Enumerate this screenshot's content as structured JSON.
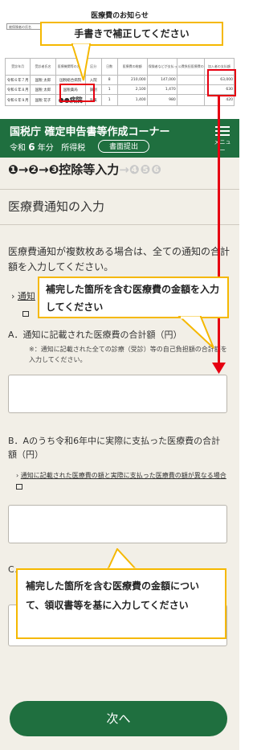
{
  "notice": {
    "title": "医療費のお知らせ",
    "insurer_label": "被保険者の氏名",
    "table_headers": [
      "受診年月",
      "受診者氏名",
      "医療機関等の名称",
      "区分",
      "日数",
      "医療費の総額",
      "保険者などが支払った額",
      "公費負担医療費の額",
      "加入者の支払額"
    ],
    "rows": [
      [
        "令和６年７月",
        "国税 太郎",
        "国税総合病院",
        "入院",
        "8",
        "210,000",
        "147,000",
        "",
        "63,000"
      ],
      [
        "令和６年８月",
        "国税 太郎",
        "国税薬局",
        "調剤",
        "1",
        "2,100",
        "1,470",
        "",
        "630"
      ],
      [
        "令和６年９月",
        "国税 花子",
        "●●病院",
        "外来",
        "1",
        "1,400",
        "980",
        "",
        "420"
      ]
    ],
    "highlight_text": "●●病院"
  },
  "callout_top": "手書きで補正してください",
  "callout_mid": "補完した箇所を含む医療費の金額を入力してください",
  "callout_bottom": "補完した箇所を含む医療費の金額について、領収書等を基に入力してください",
  "header": {
    "title": "国税庁 確定申告書等作成コーナー",
    "year_prefix": "令和",
    "year_num": "6",
    "year_suffix": "年分",
    "tax_type": "所得税",
    "submit_button": "書面提出",
    "menu_label": "メニュー"
  },
  "steps": {
    "done1": "❶",
    "done2": "❷",
    "current_num": "❸",
    "current_label": "控除等入力",
    "future": "❹❺❻",
    "arrow": "→"
  },
  "page_title": "医療費通知の入力",
  "description": "医療費通知が複数枚ある場合は、全ての通知の合計額を入力してください。",
  "link1": "通知",
  "questionA": {
    "label": "A．通知に記載された医療費の合計額（円）",
    "note": "※：通知に記載された全ての診療（受診）等の自己負担額の合計額を入力してください。"
  },
  "questionB": {
    "label": "B．Aのうち令和6年中に実際に支払った医療費の合計額（円）",
    "link": "通知に記載された医療費の額と実際に支払った医療費の額が異なる場合"
  },
  "questionC": {
    "label": "C．",
    "note": "て"
  },
  "next_button": "次へ"
}
